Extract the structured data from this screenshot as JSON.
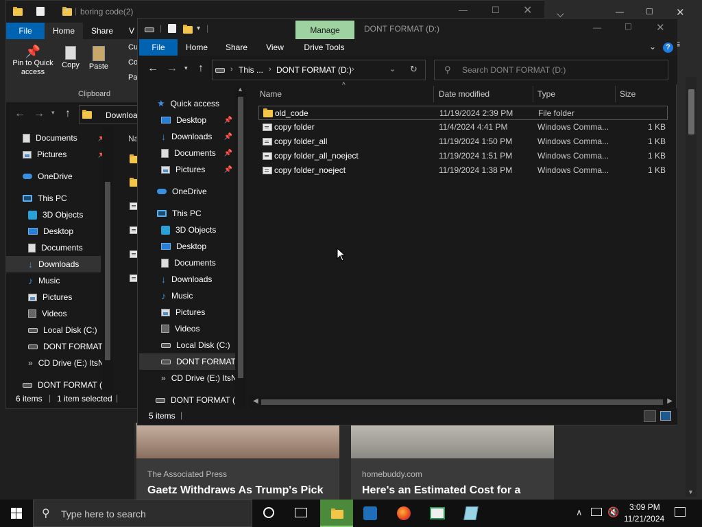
{
  "background_window": {
    "title": "boring code(2)",
    "tabs": [
      "File",
      "Home",
      "Share",
      "V"
    ],
    "clipboard": {
      "pin_label": "Pin to Quick access",
      "copy_label": "Copy",
      "paste_label": "Paste",
      "cut_label": "Cu",
      "copy_path_label": "Co",
      "paste_shortcut_label": "Pas",
      "group_label": "Clipboard"
    },
    "address_text": "Downloa",
    "col_name_partial": "Na",
    "nav": [
      {
        "label": "Documents",
        "icon": "documents-icon",
        "pinned": true
      },
      {
        "label": "Pictures",
        "icon": "pictures-icon",
        "pinned": true
      },
      {
        "label": "OneDrive",
        "icon": "onedrive-icon"
      },
      {
        "label": "This PC",
        "icon": "pc-icon"
      },
      {
        "label": "3D Objects",
        "icon": "3d-objects-icon"
      },
      {
        "label": "Desktop",
        "icon": "desktop-icon"
      },
      {
        "label": "Documents",
        "icon": "documents-icon"
      },
      {
        "label": "Downloads",
        "icon": "downloads-icon"
      },
      {
        "label": "Music",
        "icon": "music-icon"
      },
      {
        "label": "Pictures",
        "icon": "pictures-icon"
      },
      {
        "label": "Videos",
        "icon": "videos-icon"
      },
      {
        "label": "Local Disk (C:)",
        "icon": "drive-icon"
      },
      {
        "label": "DONT FORMAT (",
        "icon": "drive-icon"
      },
      {
        "label": "CD Drive (E:) ItsN",
        "icon": "cd-drive-icon"
      },
      {
        "label": "DONT FORMAT (D",
        "icon": "drive-icon"
      }
    ],
    "status_items": "6 items",
    "status_selected": "1 item selected"
  },
  "main_window": {
    "manage_tab": "Manage",
    "title": "DONT FORMAT (D:)",
    "ribbon_tabs": [
      "File",
      "Home",
      "Share",
      "View",
      "Drive Tools"
    ],
    "breadcrumb_root": "This ...",
    "breadcrumb_current": "DONT FORMAT (D:)",
    "search_placeholder": "Search DONT FORMAT (D:)",
    "columns": {
      "name": "Name",
      "date": "Date modified",
      "type": "Type",
      "size": "Size"
    },
    "files": [
      {
        "name": "old_code",
        "date": "11/19/2024 2:39 PM",
        "type": "File folder",
        "size": "",
        "icon": "folder-icon"
      },
      {
        "name": "copy folder",
        "date": "11/4/2024 4:41 PM",
        "type": "Windows Comma...",
        "size": "1 KB",
        "icon": "cmd-file-icon"
      },
      {
        "name": "copy folder_all",
        "date": "11/19/2024 1:50 PM",
        "type": "Windows Comma...",
        "size": "1 KB",
        "icon": "cmd-file-icon"
      },
      {
        "name": "copy folder_all_noeject",
        "date": "11/19/2024 1:51 PM",
        "type": "Windows Comma...",
        "size": "1 KB",
        "icon": "cmd-file-icon"
      },
      {
        "name": "copy folder_noeject",
        "date": "11/19/2024 1:38 PM",
        "type": "Windows Comma...",
        "size": "1 KB",
        "icon": "cmd-file-icon"
      }
    ],
    "nav": [
      {
        "label": "Quick access",
        "icon": "star-icon"
      },
      {
        "label": "Desktop",
        "icon": "desktop-icon",
        "pinned": true
      },
      {
        "label": "Downloads",
        "icon": "downloads-icon",
        "pinned": true
      },
      {
        "label": "Documents",
        "icon": "documents-icon",
        "pinned": true
      },
      {
        "label": "Pictures",
        "icon": "pictures-icon",
        "pinned": true
      },
      {
        "label": "OneDrive",
        "icon": "onedrive-icon"
      },
      {
        "label": "This PC",
        "icon": "pc-icon"
      },
      {
        "label": "3D Objects",
        "icon": "3d-objects-icon"
      },
      {
        "label": "Desktop",
        "icon": "desktop-icon"
      },
      {
        "label": "Documents",
        "icon": "documents-icon"
      },
      {
        "label": "Downloads",
        "icon": "downloads-icon"
      },
      {
        "label": "Music",
        "icon": "music-icon"
      },
      {
        "label": "Pictures",
        "icon": "pictures-icon"
      },
      {
        "label": "Videos",
        "icon": "videos-icon"
      },
      {
        "label": "Local Disk (C:)",
        "icon": "drive-icon"
      },
      {
        "label": "DONT FORMAT (",
        "icon": "drive-icon"
      },
      {
        "label": "CD Drive (E:) ItsN",
        "icon": "cd-drive-icon"
      },
      {
        "label": "DONT FORMAT (D",
        "icon": "drive-icon"
      }
    ],
    "status_items": "5 items"
  },
  "news": {
    "card1": {
      "source": "The Associated Press",
      "headline": "Gaetz Withdraws As Trump's Pick"
    },
    "card2": {
      "source": "homebuddy.com",
      "headline": "Here's an Estimated Cost for a"
    }
  },
  "taskbar": {
    "search_placeholder": "Type here to search",
    "time": "3:09 PM",
    "date": "11/21/2024"
  },
  "colors": {
    "accent": "#0063b1",
    "manage_tab": "#9ed2a0",
    "window_bg": "#191919",
    "ribbon_bg": "#2b2b2b"
  }
}
